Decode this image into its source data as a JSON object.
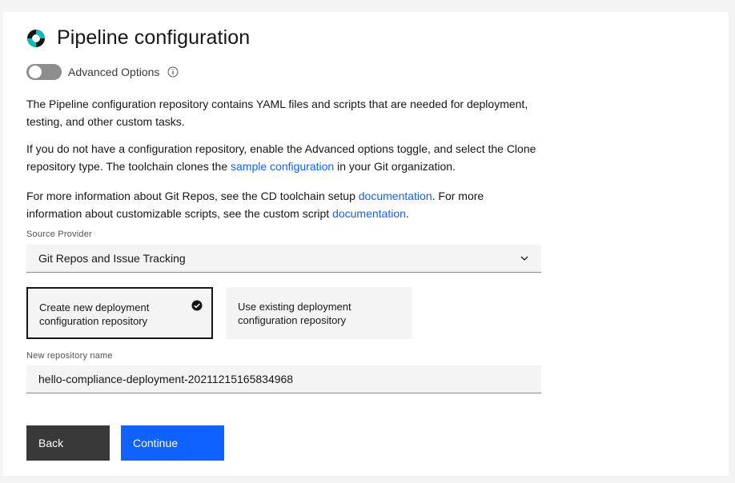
{
  "header": {
    "title": "Pipeline configuration",
    "logo_icon": "toolchain-ring-icon"
  },
  "advanced_toggle": {
    "label": "Advanced Options",
    "state": "off",
    "info_icon": "info-icon"
  },
  "description": {
    "p1": "The Pipeline configuration repository contains YAML files and scripts that are needed for deployment, testing, and other custom tasks.",
    "p2_before": "If you do not have a configuration repository, enable the Advanced options toggle, and select the Clone repository type. The toolchain clones the ",
    "p2_link": "sample configuration",
    "p2_after": " in your Git organization.",
    "p3_before": "For more information about Git Repos, see the CD toolchain setup ",
    "p3_link1": "documentation",
    "p3_middle": ". For more information about customizable scripts, see the custom script ",
    "p3_link2": "documentation",
    "p3_after": "."
  },
  "source_provider": {
    "label": "Source Provider",
    "value": "Git Repos and Issue Tracking"
  },
  "repo_options": [
    {
      "label": "Create new deployment configuration repository",
      "selected": true
    },
    {
      "label": "Use existing deployment configuration repository",
      "selected": false
    }
  ],
  "repo_name": {
    "label": "New repository name",
    "value": "hello-compliance-deployment-20211215165834968"
  },
  "buttons": {
    "back": "Back",
    "continue": "Continue"
  },
  "colors": {
    "primary": "#0f62fe",
    "secondary_button": "#393939",
    "logo_teal": "#08bdba",
    "logo_dark": "#161616"
  }
}
